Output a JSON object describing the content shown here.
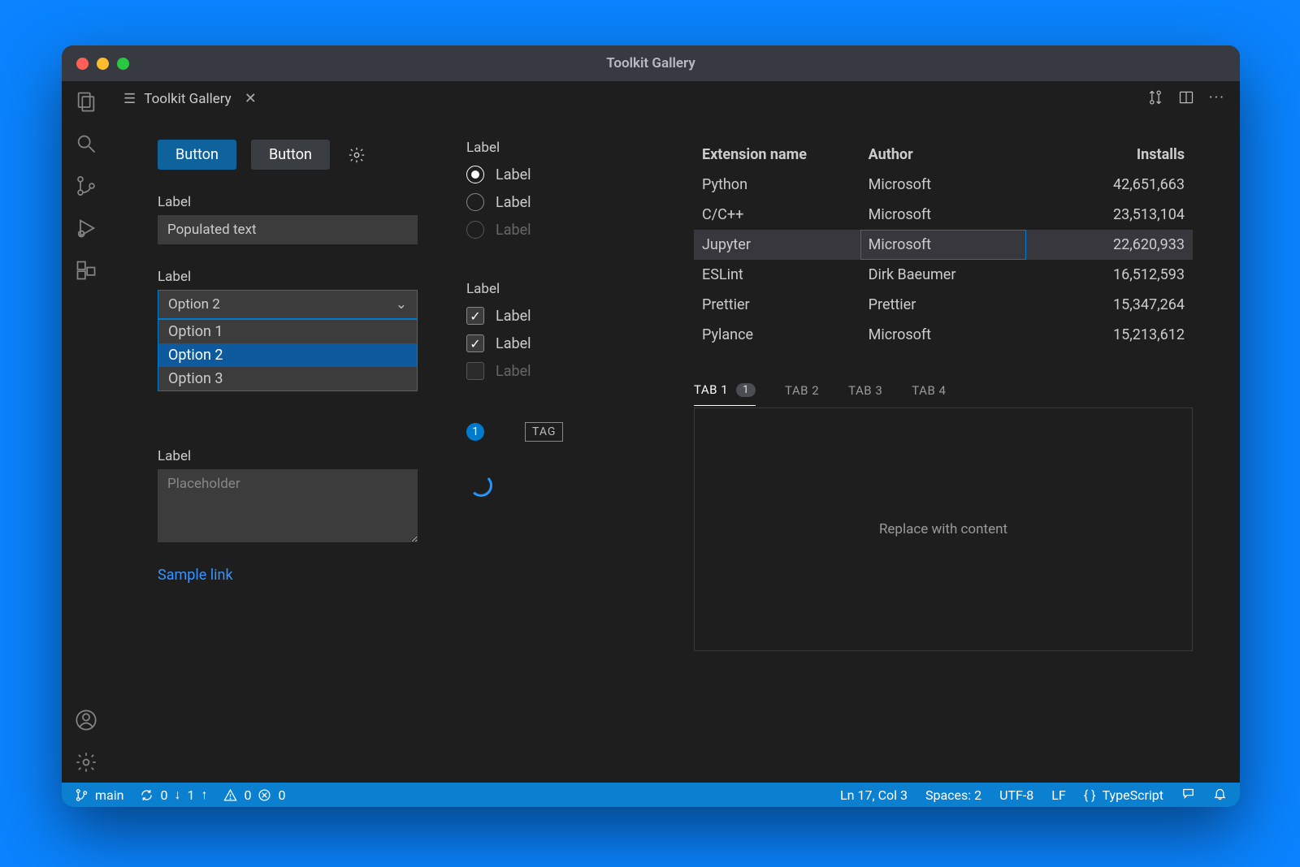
{
  "window": {
    "title": "Toolkit Gallery"
  },
  "tab": {
    "title": "Toolkit Gallery"
  },
  "buttons": {
    "primary": "Button",
    "secondary": "Button"
  },
  "textfield": {
    "label": "Label",
    "value": "Populated text"
  },
  "dropdown": {
    "label": "Label",
    "selected": "Option 2",
    "options": [
      "Option 1",
      "Option 2",
      "Option 3"
    ]
  },
  "textarea": {
    "label": "Label",
    "placeholder": "Placeholder"
  },
  "link": {
    "text": "Sample link"
  },
  "radio": {
    "label": "Label",
    "items": [
      "Label",
      "Label",
      "Label"
    ]
  },
  "checkbox": {
    "label": "Label",
    "items": [
      "Label",
      "Label",
      "Label"
    ]
  },
  "badge": {
    "value": "1"
  },
  "tag": {
    "value": "TAG"
  },
  "table": {
    "headers": {
      "name": "Extension name",
      "author": "Author",
      "installs": "Installs"
    },
    "rows": [
      {
        "name": "Python",
        "author": "Microsoft",
        "installs": "42,651,663"
      },
      {
        "name": "C/C++",
        "author": "Microsoft",
        "installs": "23,513,104"
      },
      {
        "name": "Jupyter",
        "author": "Microsoft",
        "installs": "22,620,933"
      },
      {
        "name": "ESLint",
        "author": "Dirk Baeumer",
        "installs": "16,512,593"
      },
      {
        "name": "Prettier",
        "author": "Prettier",
        "installs": "15,347,264"
      },
      {
        "name": "Pylance",
        "author": "Microsoft",
        "installs": "15,213,612"
      }
    ]
  },
  "tabs": {
    "items": [
      "TAB 1",
      "TAB 2",
      "TAB 3",
      "TAB 4"
    ],
    "badge": "1",
    "panel": "Replace with content"
  },
  "status": {
    "branch": "main",
    "sync_down": "0",
    "sync_up": "1",
    "warnings": "0",
    "errors": "0",
    "cursor": "Ln 17, Col 3",
    "spaces": "Spaces: 2",
    "encoding": "UTF-8",
    "eol": "LF",
    "language": "TypeScript"
  }
}
